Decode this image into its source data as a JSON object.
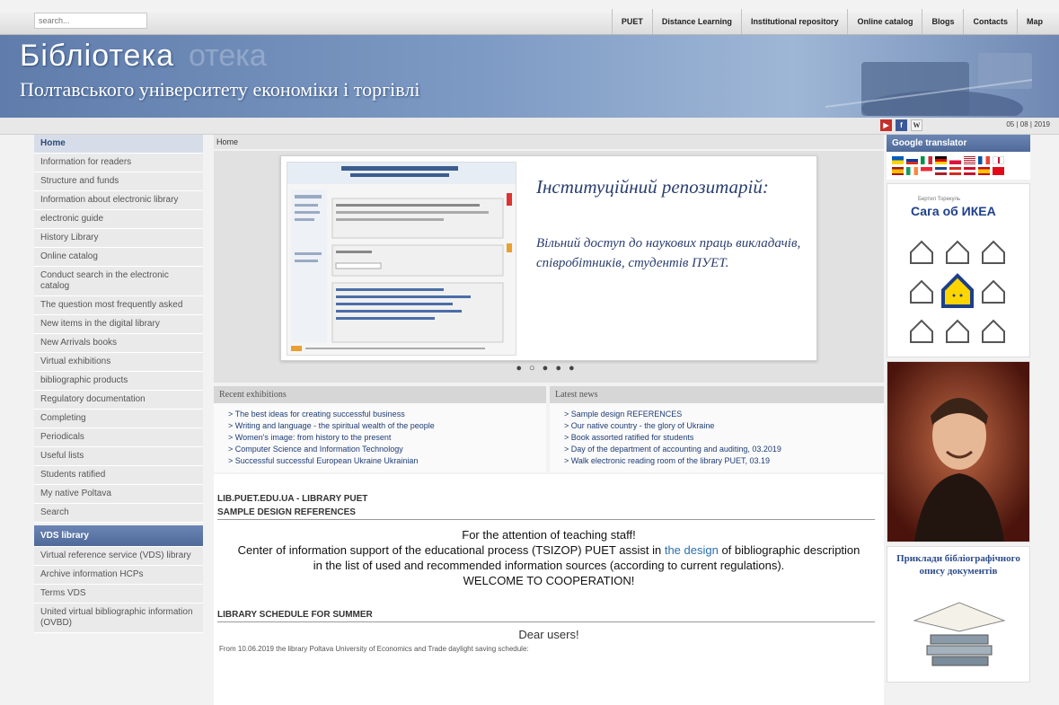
{
  "search": {
    "placeholder": "search..."
  },
  "topnav": [
    "PUET",
    "Distance Learning",
    "Institutional repository",
    "Online catalog",
    "Blogs",
    "Contacts",
    "Map"
  ],
  "banner": {
    "title": "Бібліотека",
    "ghost": "отека",
    "subtitle": "Полтавського університету економіки і торгівлі"
  },
  "social": {
    "date": "05 | 08 | 2019",
    "w_label": "W"
  },
  "sidebar": {
    "items": [
      "Home",
      "Information for readers",
      "Structure and funds",
      "Information about electronic library",
      "electronic guide",
      "History Library",
      "Online catalog",
      "Conduct search in the electronic catalog",
      "The question most frequently asked",
      "New items in the digital library",
      "New Arrivals books",
      "Virtual exhibitions",
      "bibliographic products",
      "Regulatory documentation",
      "Completing",
      "Periodicals",
      "Useful lists",
      "Students ratified",
      "My native Poltava",
      "Search"
    ],
    "vds_heading": "VDS library",
    "vds_items": [
      "Virtual reference service (VDS) library",
      "Archive information HCPs",
      "Terms VDS",
      "United virtual bibliographic information (OVBD)"
    ]
  },
  "breadcrumb": "Home",
  "slide": {
    "heading": "Інституційний репозитарій:",
    "text": "Вільний доступ до наукових праць викладачів, співробітників, студентів ПУЕТ."
  },
  "recent": {
    "heading": "Recent exhibitions",
    "items": [
      "> The best ideas for creating successful business",
      "> Writing and language - the spiritual wealth of the people",
      "> Women's image: from history to the present",
      "> Computer Science and Information Technology",
      "> Successful successful European Ukraine Ukrainian"
    ]
  },
  "news": {
    "heading": "Latest news",
    "items": [
      "> Sample design REFERENCES",
      "> Our native country - the glory of Ukraine",
      "> Book assorted ratified for students",
      "> Day of the department of accounting and auditing, 03.2019",
      "> Walk electronic reading room of the library PUET, 03.19"
    ]
  },
  "main": {
    "site_heading": "LIB.PUET.EDU.UA - LIBRARY PUET",
    "section1": "SAMPLE DESIGN REFERENCES",
    "attention1": "For the attention of teaching staff!",
    "attention2a": "Center of information support of the educational process (TSIZOP) PUET assist in",
    "attention_link": "the design",
    "attention2b": "of bibliographic description in the list of used and recommended information sources (according to current regulations).",
    "welcome": "WELCOME TO COOPERATION!",
    "section2": "LIBRARY SCHEDULE FOR SUMMER",
    "dear": "Dear users!",
    "schedule": "From 10.06.2019 the library Poltava University of Economics and Trade daylight saving schedule:"
  },
  "right": {
    "gt_heading": "Google translator",
    "ikea_author": "Бертил Торекуль",
    "ikea_title": "Сага об ИКЕА",
    "book_title": "Приклади бібліографічного опису документів"
  },
  "colors": {
    "accent": "#4f6a99",
    "link": "#1f3d75"
  }
}
